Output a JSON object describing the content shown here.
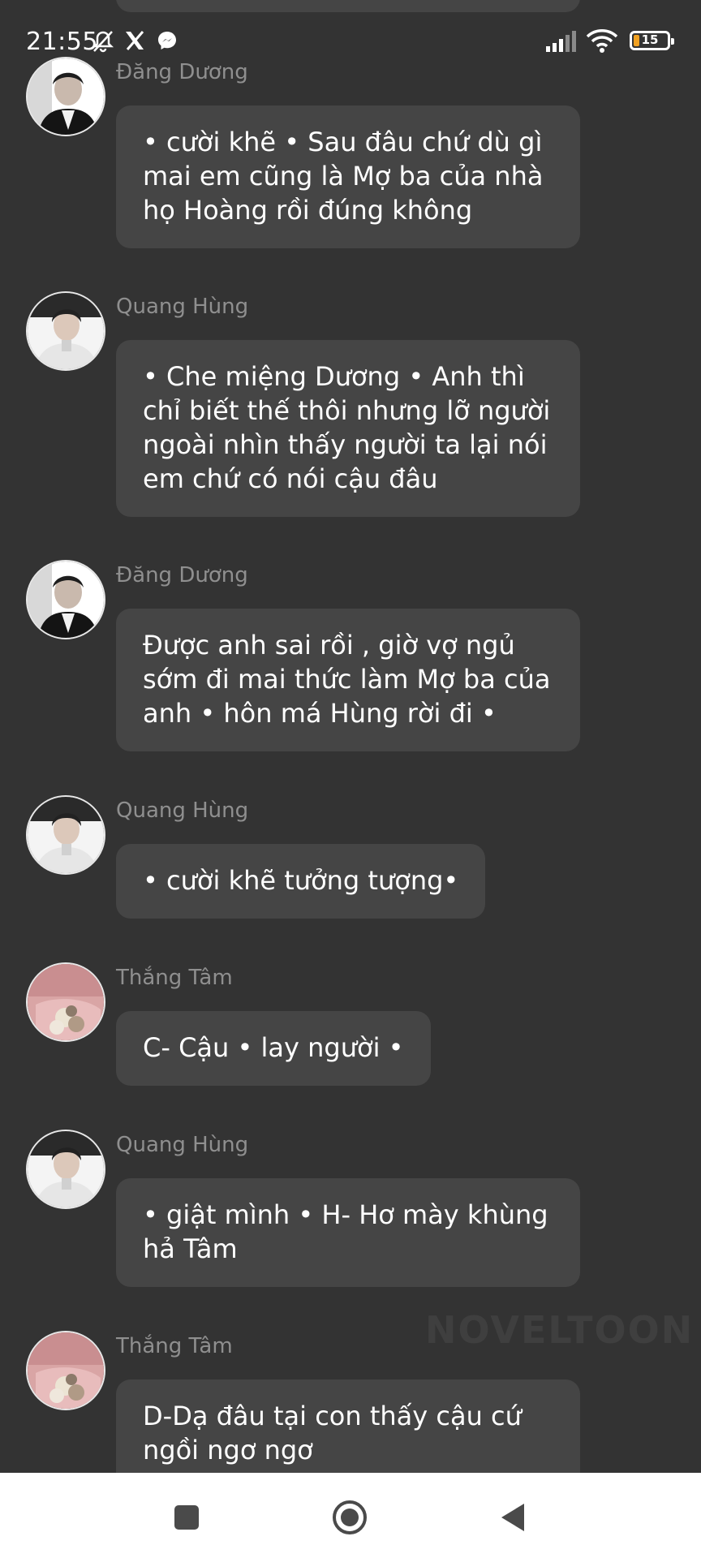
{
  "status_bar": {
    "time": "21:55",
    "battery_level": "15",
    "icons": [
      "notifications-muted-icon",
      "x-app-icon",
      "messenger-icon",
      "signal-icon",
      "wifi-icon",
      "battery-icon"
    ]
  },
  "messages": [
    {
      "sender": "Đăng Dương",
      "avatar": "avatar-dang-duong",
      "text": "• cười khẽ • Sau đâu chứ dù gì mai em cũng là Mợ ba của nhà họ Hoàng rồi đúng không"
    },
    {
      "sender": "Quang Hùng",
      "avatar": "avatar-quang-hung",
      "text": "• Che miệng Dương • Anh thì chỉ biết thế thôi nhưng lỡ người ngoài nhìn thấy người ta lại nói em chứ có nói cậu đâu"
    },
    {
      "sender": "Đăng Dương",
      "avatar": "avatar-dang-duong",
      "text": "Được anh sai rồi , giờ vợ ngủ sớm đi mai thức làm Mợ ba của anh • hôn má Hùng rời đi •"
    },
    {
      "sender": "Quang Hùng",
      "avatar": "avatar-quang-hung",
      "text": "• cười khẽ tưởng tượng•"
    },
    {
      "sender": "Thắng Tâm",
      "avatar": "avatar-thang-tam",
      "text": "C- Cậu • lay người •"
    },
    {
      "sender": "Quang Hùng",
      "avatar": "avatar-quang-hung",
      "text": "• giật mình • H- Hơ mày khùng hả Tâm"
    },
    {
      "sender": "Thắng Tâm",
      "avatar": "avatar-thang-tam",
      "text": "D-Dạ đâu tại con thấy cậu cứ ngồi ngơ ngơ"
    }
  ],
  "watermark": "NOVELTOON",
  "nav_bar": {
    "buttons": [
      "recent-apps-button",
      "home-button",
      "back-button"
    ]
  },
  "colors": {
    "background": "#333333",
    "bubble": "#454545",
    "sender_name": "#8f8f8f",
    "battery_low": "#f0a020"
  }
}
